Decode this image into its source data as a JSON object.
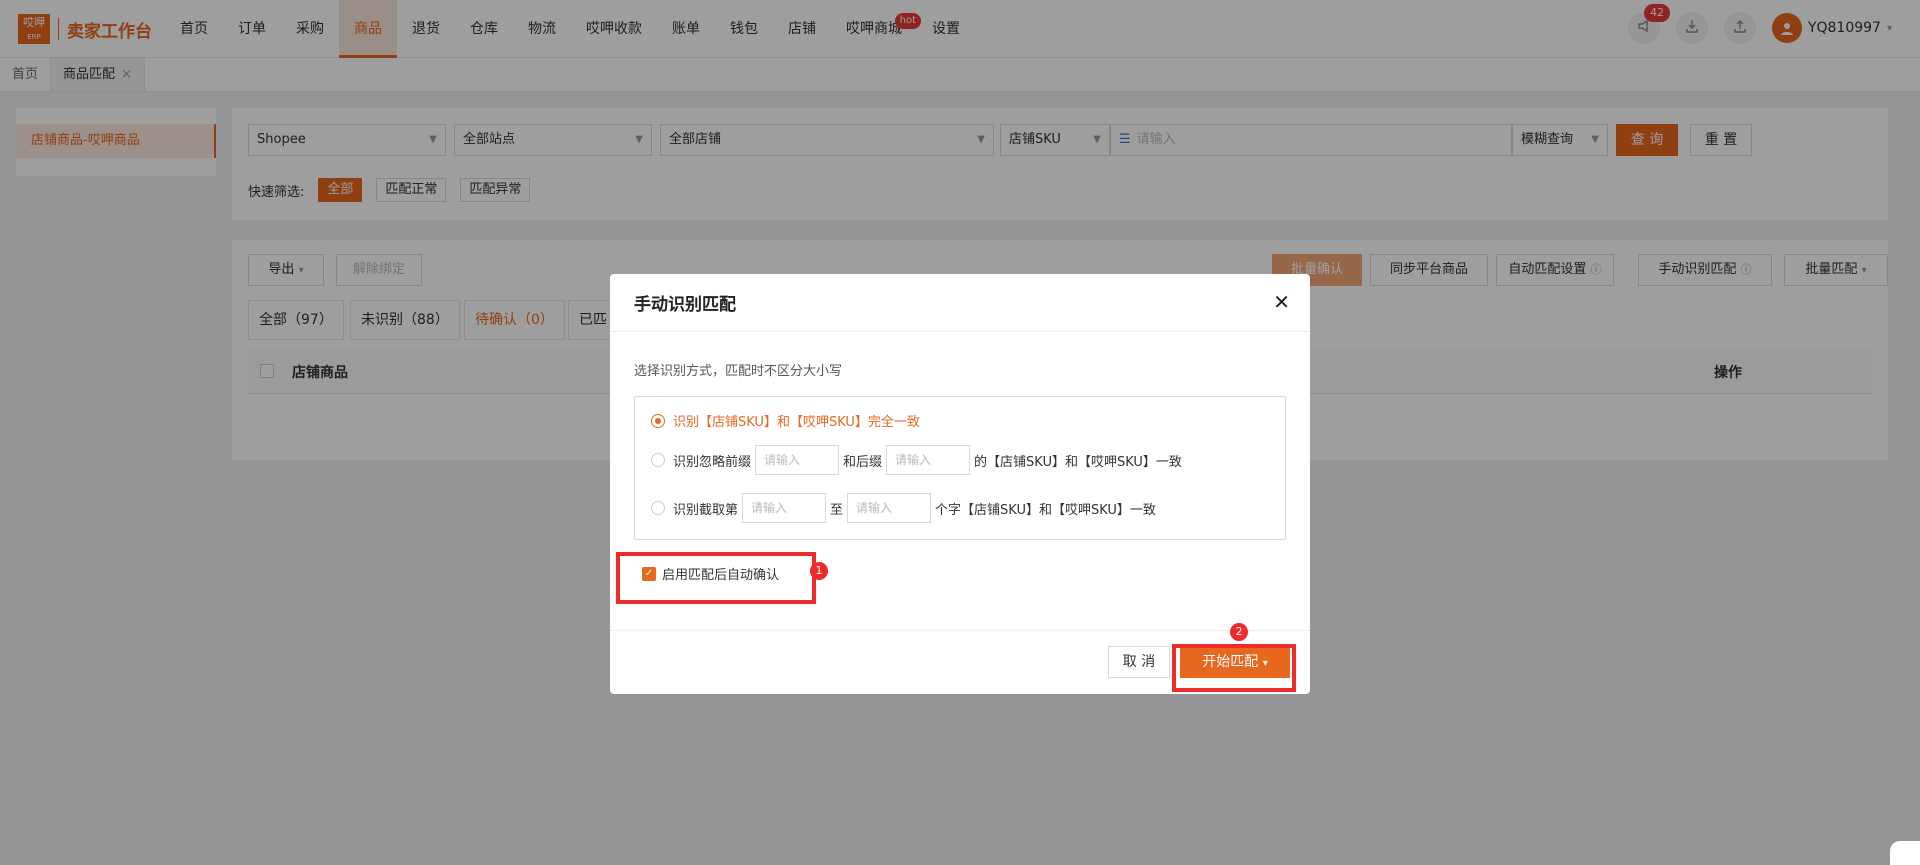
{
  "logo": {
    "mark_top": "哎呷",
    "mark_bottom": "ERP",
    "title": "卖家工作台"
  },
  "nav": [
    {
      "label": "首页"
    },
    {
      "label": "订单"
    },
    {
      "label": "采购"
    },
    {
      "label": "商品",
      "active": true
    },
    {
      "label": "退货"
    },
    {
      "label": "仓库"
    },
    {
      "label": "物流"
    },
    {
      "label": "哎呷收款"
    },
    {
      "label": "账单"
    },
    {
      "label": "钱包"
    },
    {
      "label": "店铺"
    },
    {
      "label": "哎呷商城",
      "badge": "hot"
    },
    {
      "label": "设置"
    }
  ],
  "header_right": {
    "notif_count": "42",
    "username": "YQ810997"
  },
  "page_tabs": [
    {
      "label": "首页"
    },
    {
      "label": "商品匹配"
    }
  ],
  "sidebar": {
    "item": "店铺商品-哎呷商品"
  },
  "filters": {
    "platform": "Shopee",
    "site": "全部站点",
    "store": "全部店铺",
    "sku_type": "店铺SKU",
    "search_placeholder": "请输入",
    "search_mode": "模糊查询",
    "query": "查 询",
    "reset": "重 置",
    "quick_label": "快速筛选:",
    "quick": [
      "全部",
      "匹配正常",
      "匹配异常"
    ]
  },
  "toolbar": {
    "export": "导出",
    "unbind": "解除绑定",
    "batch_confirm": "批量确认",
    "sync": "同步平台商品",
    "auto_settings": "自动匹配设置",
    "manual": "手动识别匹配",
    "batch_match": "批量匹配"
  },
  "status_tabs": [
    "全部（97）",
    "未识别（88）",
    "待确认（0）",
    "已匹"
  ],
  "table": {
    "col_product": "店铺商品",
    "col_action": "操作"
  },
  "modal": {
    "title": "手动识别匹配",
    "hint": "选择识别方式，匹配时不区分大小写",
    "rule1": "识别【店铺SKU】和【哎呷SKU】完全一致",
    "rule2_a": "识别忽略前缀",
    "rule2_b": "和后缀",
    "rule2_c": "的【店铺SKU】和【哎呷SKU】一致",
    "rule3_a": "识别截取第",
    "rule3_b": "至",
    "rule3_c": "个字【店铺SKU】和【哎呷SKU】一致",
    "input_placeholder": "请输入",
    "auto_confirm": "启用匹配后自动确认",
    "cancel": "取 消",
    "start": "开始匹配",
    "annot1": "1",
    "annot2": "2"
  },
  "colors": {
    "accent": "#e8671f",
    "annotation": "#ee2b2b"
  }
}
